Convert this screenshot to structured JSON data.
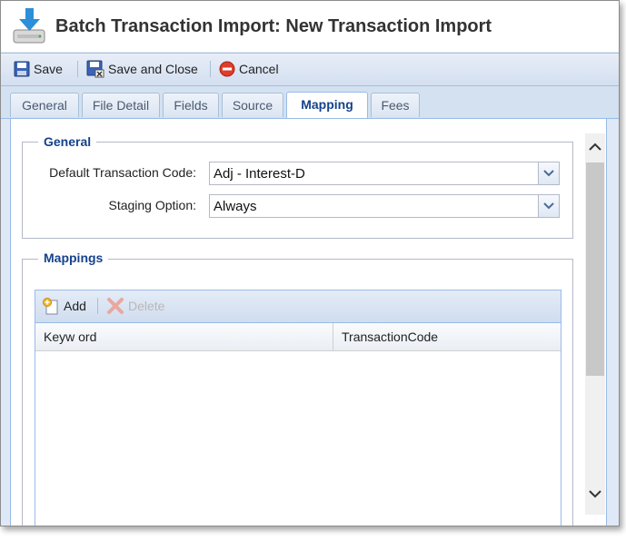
{
  "window": {
    "title": "Batch Transaction Import: New Transaction Import"
  },
  "toolbar": {
    "save": "Save",
    "save_and_close": "Save and Close",
    "cancel": "Cancel"
  },
  "tabs": [
    {
      "label": "General",
      "active": false
    },
    {
      "label": "File Detail",
      "active": false
    },
    {
      "label": "Fields",
      "active": false
    },
    {
      "label": "Source",
      "active": false
    },
    {
      "label": "Mapping",
      "active": true
    },
    {
      "label": "Fees",
      "active": false
    }
  ],
  "general_section": {
    "legend": "General",
    "default_transaction_code": {
      "label": "Default Transaction Code:",
      "value": "Adj - Interest-D"
    },
    "staging_option": {
      "label": "Staging Option:",
      "value": "Always"
    }
  },
  "mappings_section": {
    "legend": "Mappings",
    "add_label": "Add",
    "delete_label": "Delete",
    "columns": [
      "Keyw ord",
      "TransactionCode"
    ],
    "rows": []
  },
  "colors": {
    "accent": "#15428b",
    "border": "#99bbe8",
    "cancel_icon": "#e03c2c"
  }
}
